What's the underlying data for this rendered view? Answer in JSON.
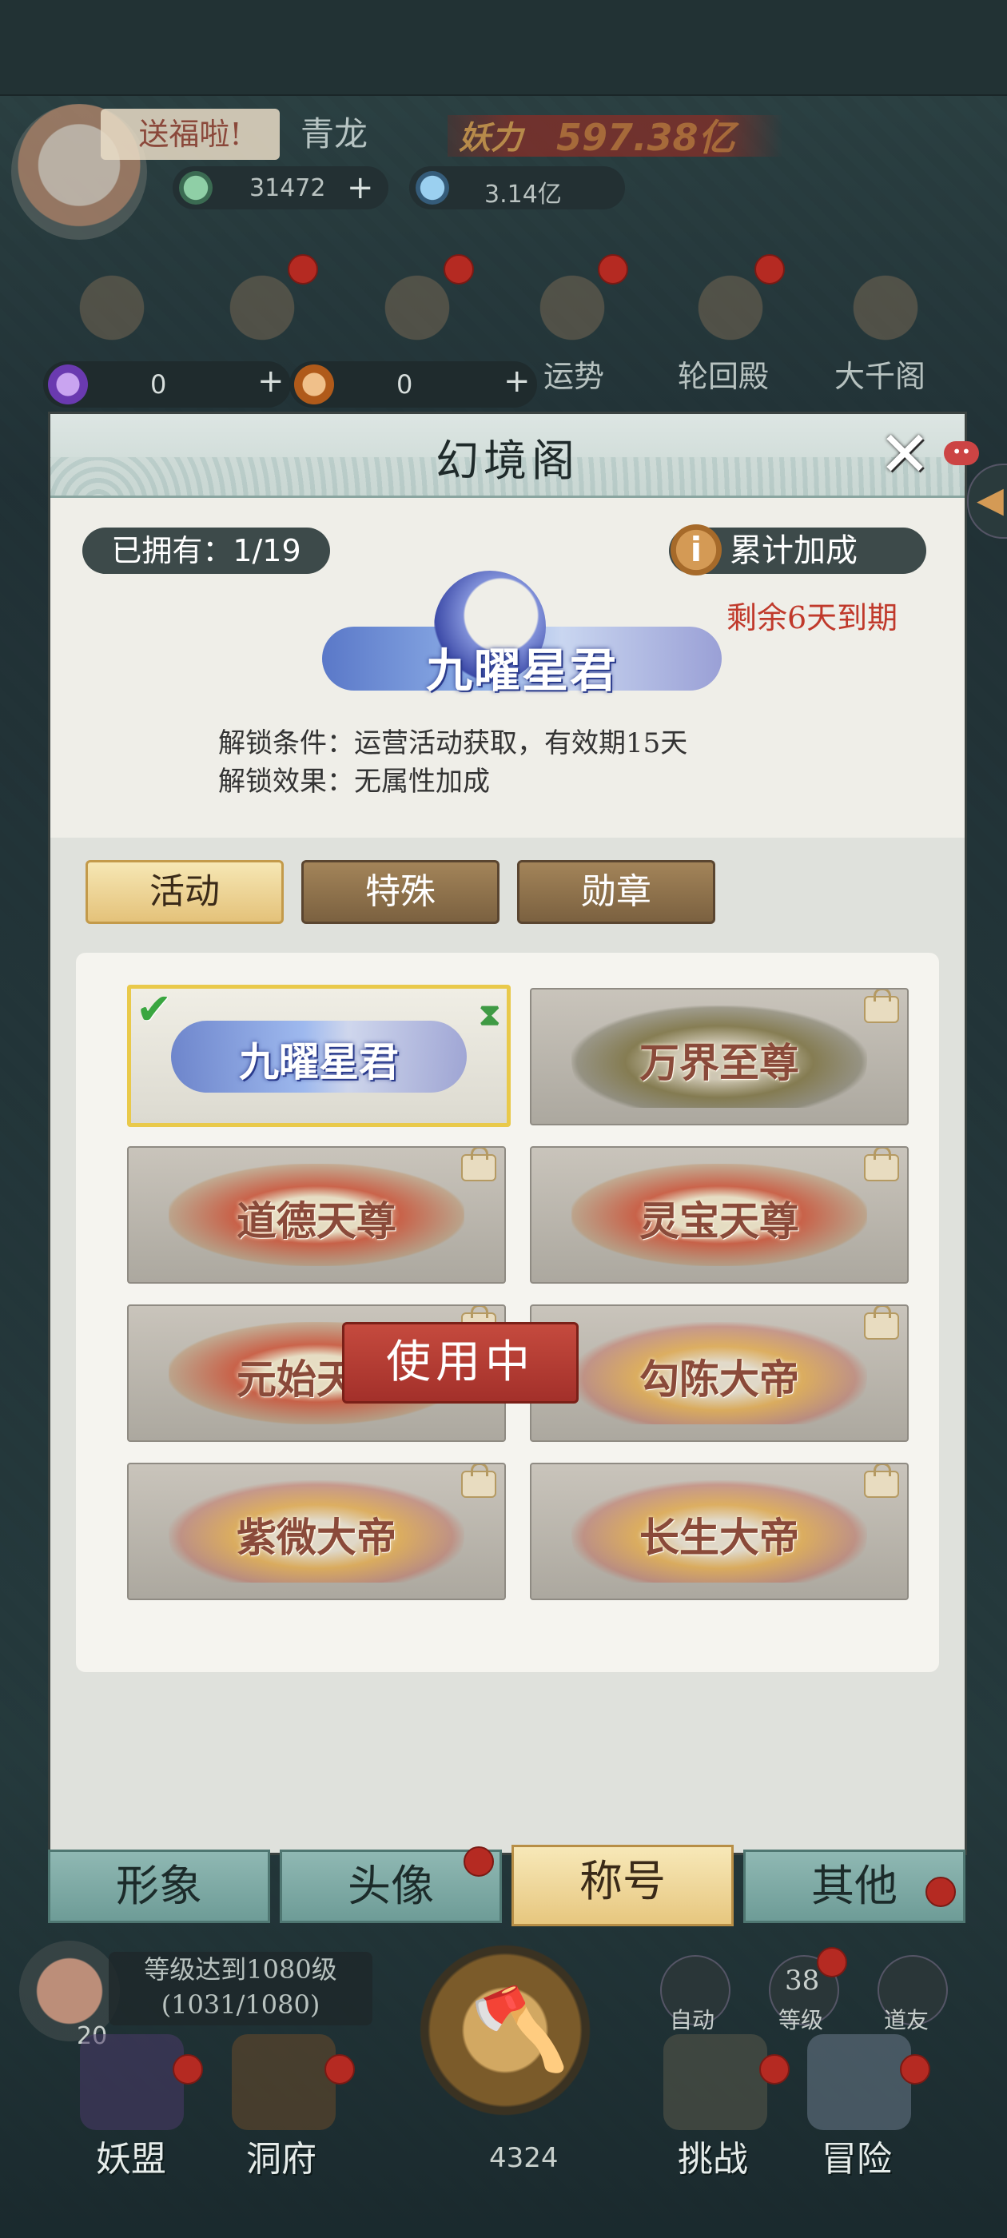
{
  "header": {
    "gift_tag": "送福啦!",
    "player_name": "青龙",
    "power_label": "妖力",
    "power_value": "597.38亿",
    "currency1": "31472",
    "currency2": "3.14亿",
    "plus": "+"
  },
  "top_icons": [
    "",
    "",
    "",
    "运势",
    "轮回殿",
    "大千阁"
  ],
  "small_pills": [
    {
      "value": "0",
      "plus": "+"
    },
    {
      "value": "0",
      "plus": "+"
    }
  ],
  "dialog": {
    "title": "幻境阁",
    "close": "✕",
    "close_dot": "••",
    "owned": "已拥有：1/19",
    "bonus_icon": "i",
    "bonus_label": "累计加成",
    "expire": "剩余6天到期",
    "featured_title": "九曜星君",
    "condition": "解锁条件：运营活动获取，有效期15天",
    "effect": "解锁效果：无属性加成",
    "tabs": [
      "活动",
      "特殊",
      "勋章"
    ],
    "active_tab": 0,
    "titles": [
      {
        "name": "九曜星君",
        "state": "selected"
      },
      {
        "name": "万界至尊",
        "state": "locked"
      },
      {
        "name": "道德天尊",
        "state": "locked"
      },
      {
        "name": "灵宝天尊",
        "state": "locked"
      },
      {
        "name": "元始天尊",
        "state": "locked"
      },
      {
        "name": "勾陈大帝",
        "state": "locked"
      },
      {
        "name": "紫微大帝",
        "state": "locked"
      },
      {
        "name": "长生大帝",
        "state": "locked"
      }
    ],
    "use_button": "使用中"
  },
  "bottom_tabs": [
    "形象",
    "头像",
    "称号",
    "其他"
  ],
  "active_bottom_tab": 2,
  "hud": {
    "quest_line1": "等级达到1080级",
    "quest_line2": "(1031/1080)",
    "quest_num": "20",
    "center_value": "4324",
    "auto": "自动",
    "level": "等级",
    "level_num": "38",
    "friend": "道友",
    "nav": [
      "妖盟",
      "洞府",
      "挑战",
      "冒险"
    ]
  }
}
